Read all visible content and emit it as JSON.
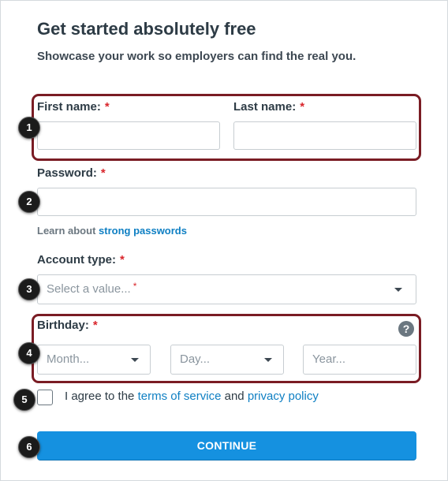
{
  "header": {
    "title": "Get started absolutely free",
    "subtitle": "Showcase your work so employers can find the real you."
  },
  "required_marker": "*",
  "form": {
    "first_name": {
      "label": "First name:",
      "value": ""
    },
    "last_name": {
      "label": "Last name:",
      "value": ""
    },
    "password": {
      "label": "Password:",
      "value": ""
    },
    "password_hint": {
      "prefix": "Learn about ",
      "link": "strong passwords"
    },
    "account_type": {
      "label": "Account type:",
      "placeholder": "Select a value..."
    },
    "birthday": {
      "label": "Birthday:",
      "help": "?",
      "month_placeholder": "Month...",
      "day_placeholder": "Day...",
      "year_placeholder": "Year..."
    },
    "agree": {
      "checked": false,
      "prefix": "I agree to the ",
      "terms_link": "terms of service",
      "middle": " and ",
      "privacy_link": "privacy policy"
    },
    "continue_label": "CONTINUE"
  },
  "callouts": [
    "1",
    "2",
    "3",
    "4",
    "5",
    "6"
  ],
  "colors": {
    "accent": "#1591e0",
    "link": "#0e7fc3",
    "required": "#d9262c",
    "highlight_border": "#7a1c24"
  }
}
